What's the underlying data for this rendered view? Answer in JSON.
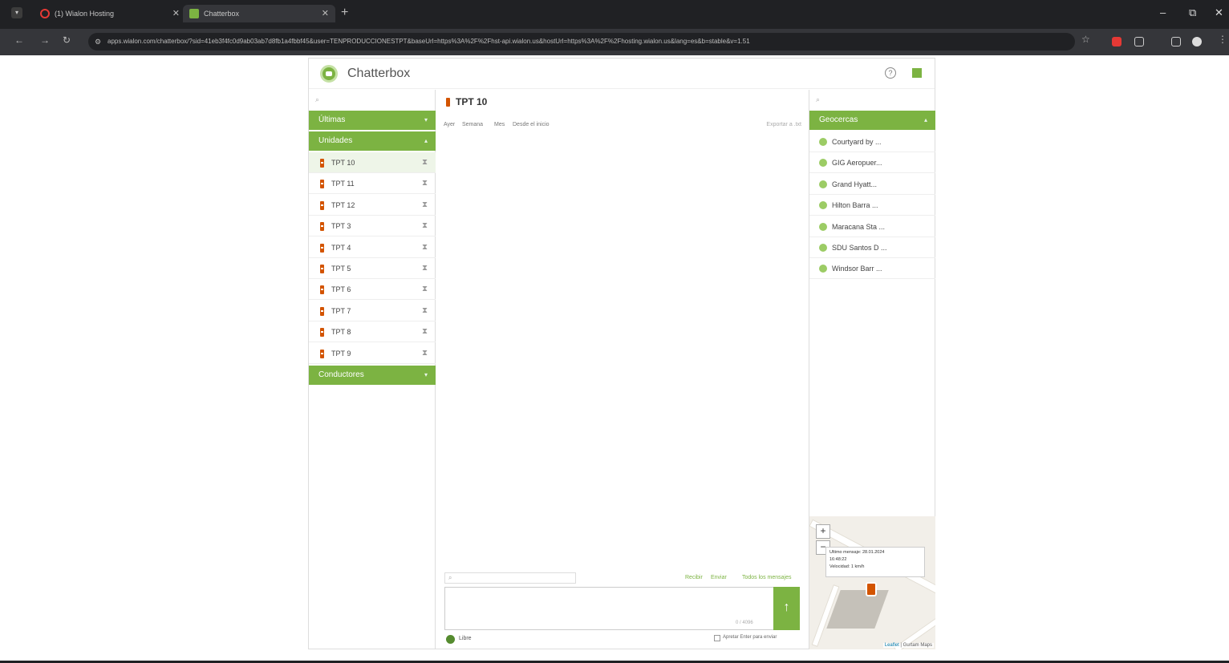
{
  "browser": {
    "tabs": [
      {
        "label": "(1) Wialon Hosting",
        "active": false
      },
      {
        "label": "Chatterbox",
        "active": true
      }
    ],
    "url": "apps.wialon.com/chatterbox/?sid=41eb3f4fc0d9ab03ab7d8fb1a4fbbf45&user=TENPRODUCCIONESTPT&baseUrl=https%3A%2F%2Fhst-api.wialon.us&hostUrl=https%3A%2F%2Fhosting.wialon.us&lang=es&b=stable&v=1.51"
  },
  "app": {
    "title": "Chatterbox",
    "search_placeholder": "",
    "sections": {
      "recent": "Últimas",
      "units": "Unidades",
      "drivers": "Conductores"
    },
    "units": [
      "TPT 10",
      "TPT 11",
      "TPT 12",
      "TPT 3",
      "TPT 4",
      "TPT 5",
      "TPT 6",
      "TPT 7",
      "TPT 8",
      "TPT 9"
    ],
    "selected_unit": "TPT 10"
  },
  "chat": {
    "title": "TPT 10",
    "filters": [
      "Ayer",
      "Semana",
      "Mes",
      "Desde el inicio"
    ],
    "export": "Exportar a .txt",
    "msg_filters": [
      "Recibir",
      "Enviar",
      "Todos los mensajes"
    ],
    "char_count": "0 / 4096",
    "status": "Libre",
    "enter_label": "Apretar Enter para enviar"
  },
  "geofences": {
    "header": "Geocercas",
    "items": [
      "Courtyard by ...",
      "GIG Aeropuer...",
      "Grand Hyatt...",
      "Hilton Barra ...",
      "Maracana Sta ...",
      "SDU Santos D ...",
      "Windsor Barr ..."
    ]
  },
  "map": {
    "popup_line1": "Ultimo mensaje: 28.01.2024",
    "popup_line2": "16:48:22",
    "popup_line3": "Velocidad: 1 km/h",
    "attribution_link": "Leaflet",
    "attribution_text": "| Gurtam Maps"
  }
}
